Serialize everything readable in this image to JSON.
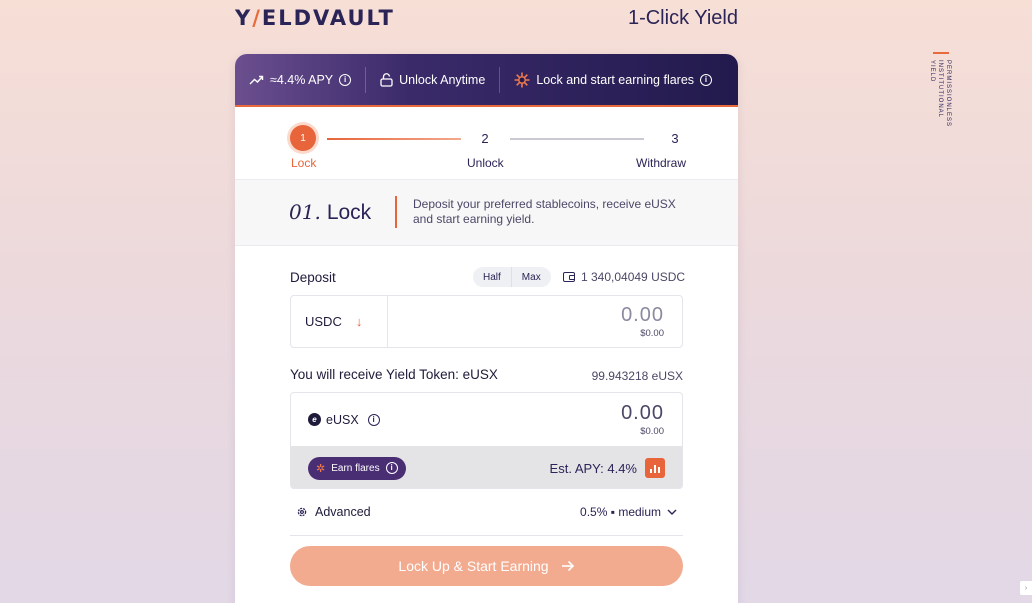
{
  "brand": {
    "logo_prefix": "Y",
    "logo_slash": "/",
    "logo_suffix": "ELDVAULT"
  },
  "page": {
    "title": "1-Click Yield"
  },
  "side_tag": {
    "text": "PERMISSIONLESS INSTITUTIONAL YIELD"
  },
  "banner": {
    "apy": "≈4.4% APY",
    "unlock": "Unlock Anytime",
    "flares": "Lock and start earning flares"
  },
  "steps": [
    {
      "number": "1",
      "label": "Lock",
      "active": true
    },
    {
      "number": "2",
      "label": "Unlock",
      "active": false
    },
    {
      "number": "3",
      "label": "Withdraw",
      "active": false
    }
  ],
  "intro": {
    "number": "01.",
    "title": "Lock",
    "description": "Deposit your preferred stablecoins, receive eUSX and start earning yield."
  },
  "deposit": {
    "label": "Deposit",
    "half": "Half",
    "max": "Max",
    "balance": "1 340,04049 USDC",
    "token": "USDC",
    "amount": "0.00",
    "usd": "$0.00"
  },
  "receive": {
    "label": "You will receive Yield Token: eUSX",
    "amount": "99.943218 eUSX",
    "token": "eUSX",
    "value": "0.00",
    "usd": "$0.00",
    "earn_flares": "Earn flares",
    "est_apy": "Est. APY: 4.4%"
  },
  "advanced": {
    "label": "Advanced",
    "slippage": "0.5% ▪ medium"
  },
  "cta": {
    "label": "Lock Up & Start Earning"
  },
  "colors": {
    "accent": "#e8643a",
    "brand_dark": "#2a2457",
    "cta": "#f3ab90"
  }
}
